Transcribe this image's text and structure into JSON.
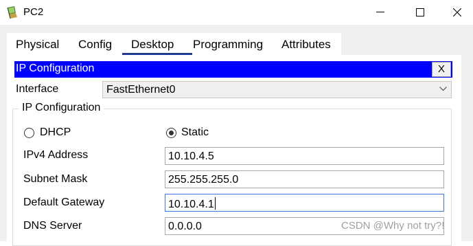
{
  "window": {
    "title": "PC2",
    "icon": "pc-icon"
  },
  "tabs": [
    {
      "label": "Physical"
    },
    {
      "label": "Config"
    },
    {
      "label": "Desktop",
      "active": true
    },
    {
      "label": "Programming"
    },
    {
      "label": "Attributes"
    }
  ],
  "ip_config": {
    "header_title": "IP Configuration",
    "close_label": "X",
    "interface_label": "Interface",
    "interface_value": "FastEthernet0",
    "group_title": "IP Configuration",
    "dhcp_label": "DHCP",
    "static_label": "Static",
    "mode_selected": "Static",
    "fields": {
      "ipv4_label": "IPv4 Address",
      "ipv4_value": "10.10.4.5",
      "subnet_label": "Subnet Mask",
      "subnet_value": "255.255.255.0",
      "gateway_label": "Default Gateway",
      "gateway_value": "10.10.4.1",
      "dns_label": "DNS Server",
      "dns_value": "0.0.0.0"
    }
  },
  "watermark": "CSDN @Why not try?!",
  "colors": {
    "header_bg": "#0000ff",
    "tab_underline": "#1f3a93",
    "focus_border": "#3c78d8"
  }
}
